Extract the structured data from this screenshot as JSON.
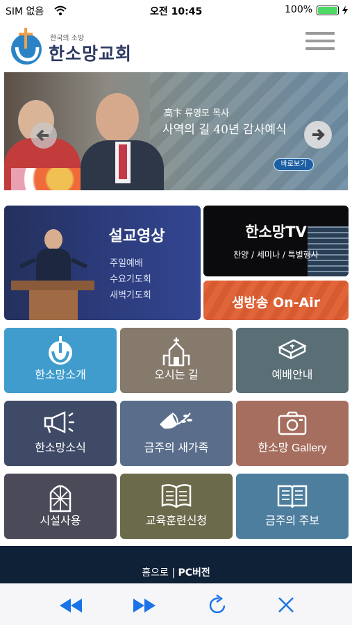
{
  "status": {
    "carrier": "SIM 없음",
    "time": "오전 10:45",
    "battery": "100%"
  },
  "header": {
    "logo_small": "한국의 소망",
    "logo_main": "한소망교회"
  },
  "hero": {
    "name": "高卞 류영모 목사",
    "title": "사역의 길 40년 감사예식",
    "button": "바로보기"
  },
  "sermon": {
    "title": "설교영상",
    "links": [
      "주일예배",
      "수요기도회",
      "새벽기도회"
    ]
  },
  "tv": {
    "title": "한소망TV",
    "subtitle": "찬양 / 세미나 / 특별행사"
  },
  "live": {
    "label": "생방송 On-Air"
  },
  "tiles": [
    {
      "label": "한소망소개",
      "icon": "church-logo-icon",
      "color": "#3f9ccd"
    },
    {
      "label": "오시는 길",
      "icon": "church-building-icon",
      "color": "#857a6c"
    },
    {
      "label": "예배안내",
      "icon": "bible-icon",
      "color": "#5a6e76"
    },
    {
      "label": "한소망소식",
      "icon": "megaphone-icon",
      "color": "#3e4a66"
    },
    {
      "label": "금주의 새가족",
      "icon": "dove-icon",
      "color": "#5a6e8b"
    },
    {
      "label": "한소망 Gallery",
      "icon": "camera-icon",
      "color": "#a56e5e"
    },
    {
      "label": "시설사용",
      "icon": "stained-window-icon",
      "color": "#4a4a58"
    },
    {
      "label": "교육훈련신청",
      "icon": "open-book-icon",
      "color": "#6b6b4c"
    },
    {
      "label": "금주의 주보",
      "icon": "bulletin-icon",
      "color": "#4e7e9e"
    }
  ],
  "footer": {
    "home": "홈으로",
    "sep": "|",
    "pc": "PC버전"
  }
}
